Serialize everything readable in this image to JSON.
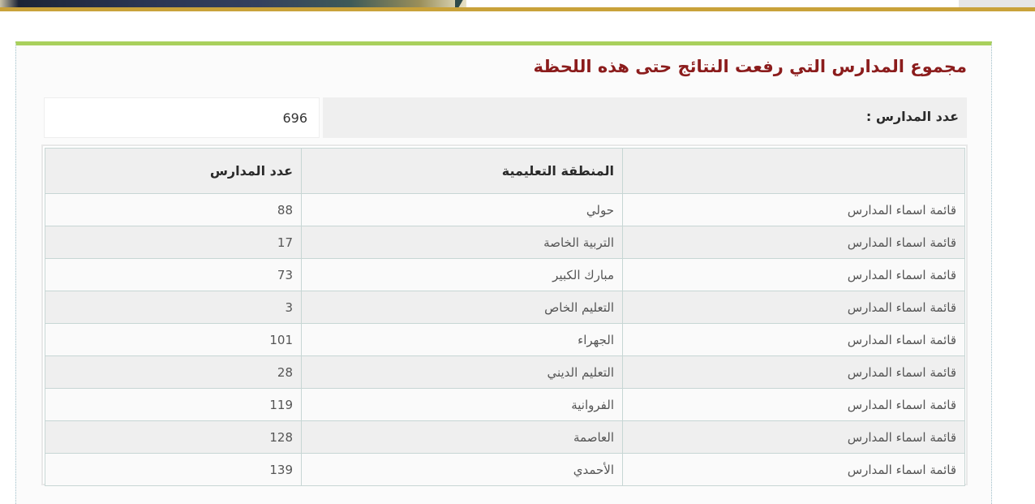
{
  "title": "مجموع المدارس التي رفعت النتائج حتى هذه اللحظة",
  "count": {
    "label": "عدد المدارس :",
    "value": "696"
  },
  "table": {
    "headers": [
      "",
      "المنطقة التعليمية",
      "عدد المدارس"
    ],
    "rows": [
      {
        "link": "قائمة اسماء المدارس",
        "region": "حولي",
        "count": "88"
      },
      {
        "link": "قائمة اسماء المدارس",
        "region": "التربية الخاصة",
        "count": "17"
      },
      {
        "link": "قائمة اسماء المدارس",
        "region": "مبارك الكبير",
        "count": "73"
      },
      {
        "link": "قائمة اسماء المدارس",
        "region": "التعليم الخاص",
        "count": "3"
      },
      {
        "link": "قائمة اسماء المدارس",
        "region": "الجهراء",
        "count": "101"
      },
      {
        "link": "قائمة اسماء المدارس",
        "region": "التعليم الديني",
        "count": "28"
      },
      {
        "link": "قائمة اسماء المدارس",
        "region": "الفروانية",
        "count": "119"
      },
      {
        "link": "قائمة اسماء المدارس",
        "region": "العاصمة",
        "count": "128"
      },
      {
        "link": "قائمة اسماء المدارس",
        "region": "الأحمدي",
        "count": "139"
      }
    ]
  },
  "colors": {
    "title": "#8b1c1c",
    "accent_bar": "#a9d05c",
    "banner_line": "#c9a23a"
  }
}
